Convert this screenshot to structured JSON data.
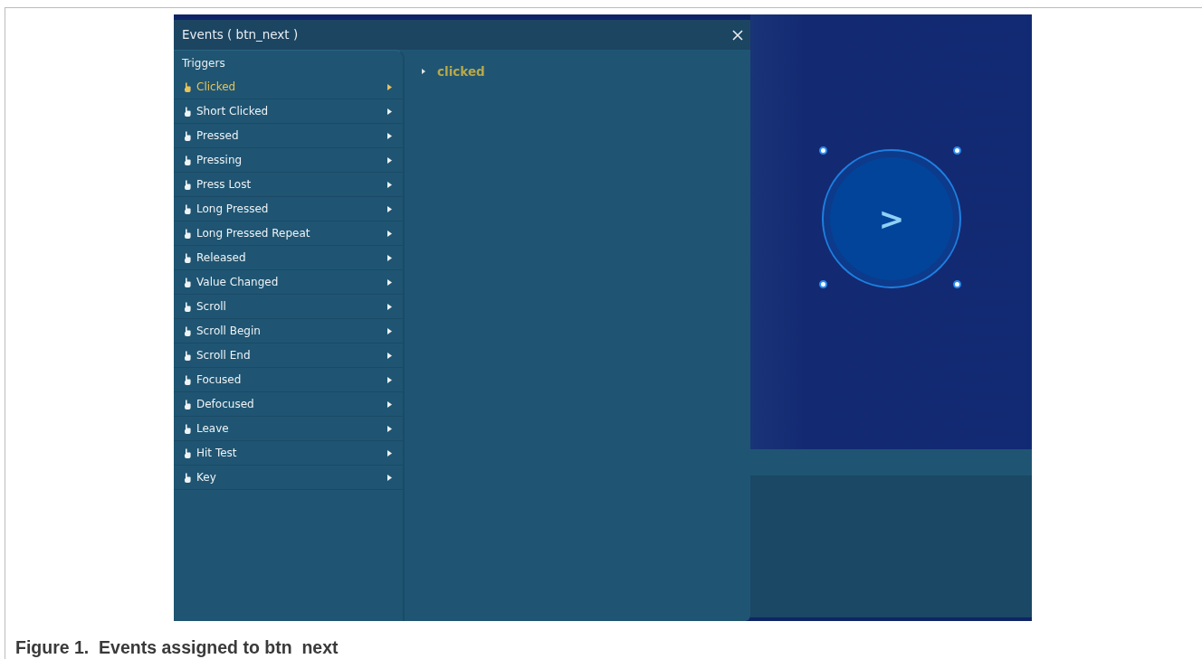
{
  "window": {
    "title": "Events ( btn_next )"
  },
  "triggers": {
    "heading": "Triggers",
    "items": [
      {
        "label": "Clicked",
        "selected": true
      },
      {
        "label": "Short Clicked",
        "selected": false
      },
      {
        "label": "Pressed",
        "selected": false
      },
      {
        "label": "Pressing",
        "selected": false
      },
      {
        "label": "Press Lost",
        "selected": false
      },
      {
        "label": "Long Pressed",
        "selected": false
      },
      {
        "label": "Long Pressed Repeat",
        "selected": false
      },
      {
        "label": "Released",
        "selected": false
      },
      {
        "label": "Value Changed",
        "selected": false
      },
      {
        "label": "Scroll",
        "selected": false
      },
      {
        "label": "Scroll Begin",
        "selected": false
      },
      {
        "label": "Scroll End",
        "selected": false
      },
      {
        "label": "Focused",
        "selected": false
      },
      {
        "label": "Defocused",
        "selected": false
      },
      {
        "label": "Leave",
        "selected": false
      },
      {
        "label": "Hit Test",
        "selected": false
      },
      {
        "label": "Key",
        "selected": false
      }
    ]
  },
  "events": [
    {
      "label": "clicked",
      "expanded": false
    }
  ],
  "canvas": {
    "button_label": ">",
    "selected": true
  },
  "caption": "Figure 1.  Events assigned to btn  next"
}
